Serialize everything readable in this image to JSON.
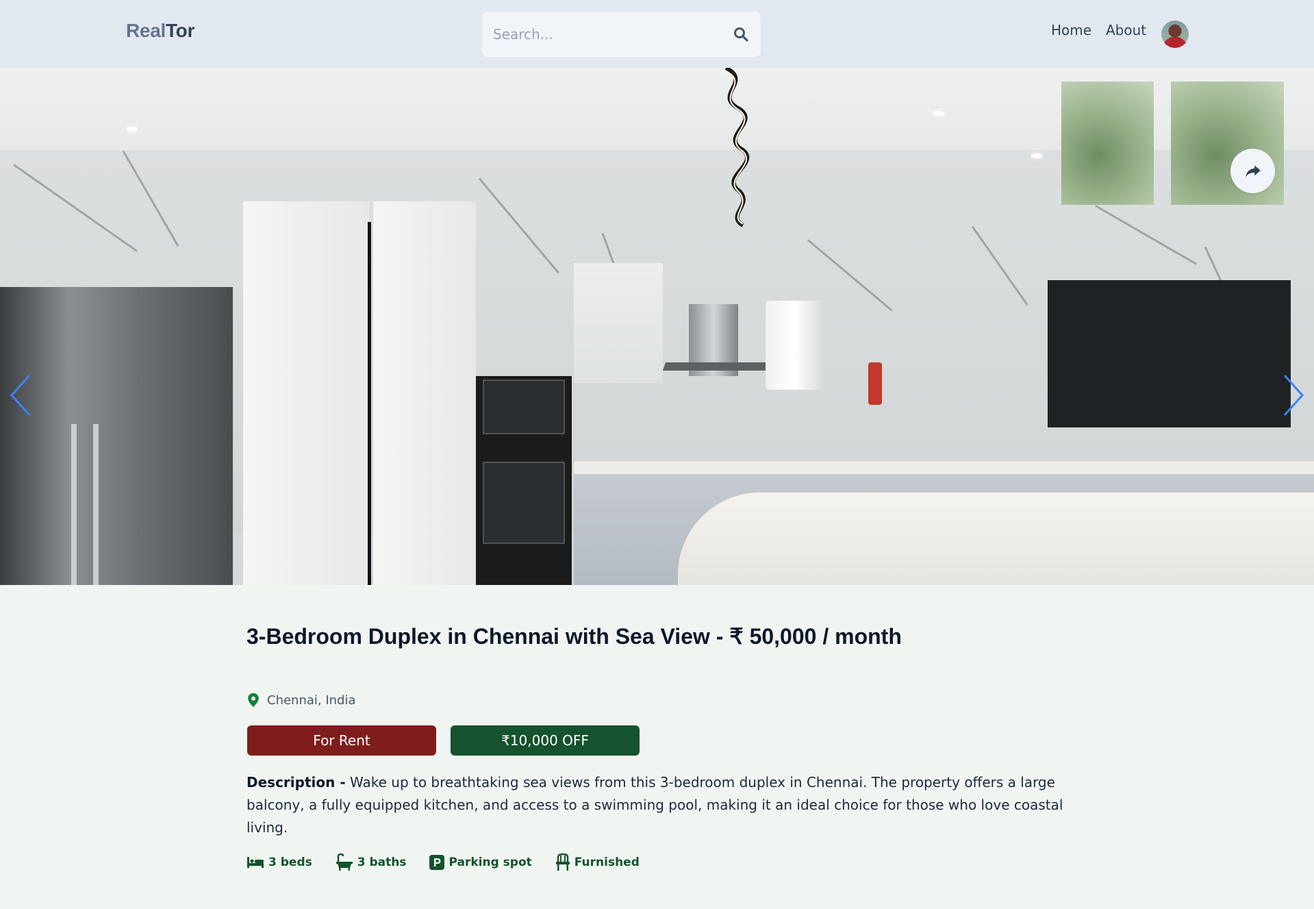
{
  "header": {
    "logo_part1": "Real",
    "logo_part2": "Tor",
    "search_placeholder": "Search...",
    "nav": [
      {
        "label": "Home"
      },
      {
        "label": "About"
      }
    ]
  },
  "listing": {
    "title": "3-Bedroom Duplex in Chennai with Sea View - ₹ 50,000 / month",
    "location": "Chennai, India",
    "type_badge": "For Rent",
    "discount_badge": "₹10,000 OFF",
    "description_label": "Description -",
    "description": " Wake up to breathtaking sea views from this 3-bedroom duplex in Chennai. The property offers a large balcony, a fully equipped kitchen, and access to a swimming pool, making it an ideal choice for those who love coastal living.",
    "features": [
      {
        "icon": "bed-icon",
        "label": "3 beds"
      },
      {
        "icon": "bath-icon",
        "label": "3 baths"
      },
      {
        "icon": "parking-icon",
        "label": "Parking spot"
      },
      {
        "icon": "chair-icon",
        "label": "Furnished"
      }
    ]
  },
  "colors": {
    "header_bg": "#e2e8f0",
    "page_bg": "#f0f5f2",
    "rent_badge": "#7f1d1d",
    "discount_badge": "#14532d",
    "feature_text": "#14532d",
    "carousel_arrow": "#3b82f6"
  },
  "icons": {
    "search": "search-icon",
    "share": "share-icon",
    "prev": "chevron-left-icon",
    "next": "chevron-right-icon",
    "location": "map-pin-icon"
  }
}
